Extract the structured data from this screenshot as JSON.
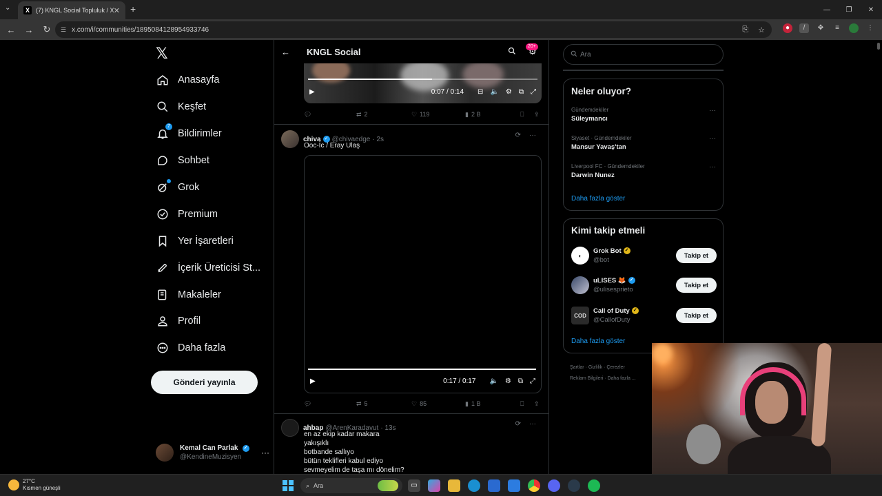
{
  "browser": {
    "tab_title": "(7) KNGL Social Topluluk / X",
    "url": "x.com/i/communities/1895084128954933746"
  },
  "sidebar": {
    "logo": "𝕏",
    "items": [
      {
        "label": "Anasayfa",
        "icon": "home-icon"
      },
      {
        "label": "Keşfet",
        "icon": "search-icon"
      },
      {
        "label": "Bildirimler",
        "icon": "bell-icon"
      },
      {
        "label": "Sohbet",
        "icon": "chat-icon"
      },
      {
        "label": "Grok",
        "icon": "grok-icon"
      },
      {
        "label": "Premium",
        "icon": "verified-icon"
      },
      {
        "label": "Yer İşaretleri",
        "icon": "bookmark-icon"
      },
      {
        "label": "İçerik Üreticisi St...",
        "icon": "rocket-icon"
      },
      {
        "label": "Makaleler",
        "icon": "article-icon"
      },
      {
        "label": "Profil",
        "icon": "person-icon"
      },
      {
        "label": "Daha fazla",
        "icon": "more-circle-icon"
      }
    ],
    "notif_count": "7",
    "post_button": "Gönderi yayınla",
    "account": {
      "name": "Kemal Can Parlak",
      "handle": "@KendineMuzisyen"
    }
  },
  "main": {
    "title": "KNGL Social",
    "badge": "20+",
    "video1": {
      "time": "0:07 / 0:14",
      "progress": 0.54
    },
    "post1_actions": {
      "replies": "",
      "reposts": "2",
      "likes": "119",
      "views": "2 B"
    },
    "post2": {
      "name": "chiva",
      "handle": "@chivaedge",
      "time": "· 2s",
      "text": "Ooc-İc / Eray Ulaş",
      "video_time": "0:17 / 0:17",
      "progress": 1.0,
      "actions": {
        "replies": "",
        "reposts": "5",
        "likes": "85",
        "views": "1 B"
      }
    },
    "post3": {
      "name": "ahbap",
      "handle": "@ArenKaradavut",
      "time": "· 13s",
      "lines": [
        "en az ekip kadar makara",
        "yakışıklı",
        "botbande sallıyo",
        "bütün teklifleri kabul ediyo",
        "sevmeyelim de taşa mı dönelim?"
      ]
    }
  },
  "right": {
    "search_placeholder": "Ara",
    "trends_title": "Neler oluyor?",
    "trends": [
      {
        "category": "Gündemdekiler",
        "name": "Süleymancı"
      },
      {
        "category": "Siyaset · Gündemdekiler",
        "name": "Mansur Yavaş'tan"
      },
      {
        "category": "Liverpool FC · Gündemdekiler",
        "name": "Darwin Nunez"
      }
    ],
    "show_more": "Daha fazla göster",
    "who_title": "Kimi takip etmeli",
    "who": [
      {
        "name": "Grok Bot",
        "handle": "@bot",
        "follow": "Takip et"
      },
      {
        "name": "uLISES 🦊",
        "handle": "@ulisesprieto",
        "follow": "Takip et"
      },
      {
        "name": "Call of Duty",
        "handle": "@CallofDuty",
        "follow": "Takip et"
      }
    ],
    "who_show_more": "Daha fazla göster",
    "footer": [
      "Şartlar",
      "Gizlilik",
      "Çerezler",
      "Reklam Bilgileri",
      "Daha fazla ..."
    ]
  },
  "taskbar": {
    "temp": "27°C",
    "weather": "Kısmen güneşli",
    "search": "Ara"
  }
}
